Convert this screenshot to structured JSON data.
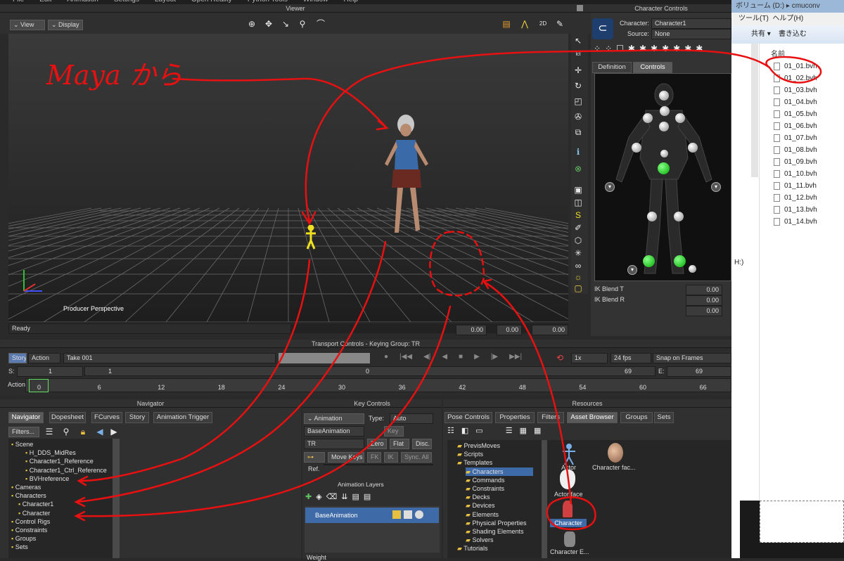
{
  "menubar": {
    "items": [
      "File",
      "Edit",
      "Animation",
      "Settings",
      "Layout",
      "Open Reality",
      "Python Tools",
      "Window",
      "Help"
    ]
  },
  "viewer": {
    "title": "Viewer",
    "view_btn": "View",
    "display_btn": "Display",
    "camera_label": "Producer Perspective",
    "status": "Ready",
    "coords": [
      "0.00",
      "0.00",
      "0.00"
    ],
    "handwriting": "Maya から"
  },
  "character_controls": {
    "title": "Character Controls",
    "character_label": "Character:",
    "character_value": "Character1",
    "source_label": "Source:",
    "source_value": "None",
    "tabs": [
      "Definition",
      "Controls"
    ],
    "active_tab": "Controls",
    "ik_rows": [
      {
        "label": "IK Blend T",
        "value": "0.00"
      },
      {
        "label": "IK Blend R",
        "value": "0.00"
      },
      {
        "label": "",
        "value": "0.00"
      }
    ]
  },
  "explorer": {
    "title_partial": "ボリューム (D:)",
    "path_partial": "cmuconv",
    "menu": [
      "ツール(T)",
      "ヘルプ(H)"
    ],
    "toolbar": [
      "共有 ▾",
      "書き込む"
    ],
    "column_header": "名前",
    "side_text": "H:)",
    "files": [
      "01_01.bvh",
      "01_02.bvh",
      "01_03.bvh",
      "01_04.bvh",
      "01_05.bvh",
      "01_06.bvh",
      "01_07.bvh",
      "01_08.bvh",
      "01_09.bvh",
      "01_10.bvh",
      "01_11.bvh",
      "01_12.bvh",
      "01_13.bvh",
      "01_14.bvh"
    ]
  },
  "transport": {
    "title": "Transport Controls  -  Keying Group: TR",
    "story": "Story",
    "action": "Action",
    "take": "Take 001",
    "speed": "1x",
    "fps": "24 fps",
    "snap": "Snap on Frames",
    "start_label": "S:",
    "start_value": "1",
    "current_value": "1",
    "center_value": "0",
    "end_frame": "69",
    "end_label": "E:",
    "end_value": "69",
    "action_label": "Action",
    "ticks": [
      "0",
      "6",
      "12",
      "18",
      "24",
      "30",
      "36",
      "42",
      "48",
      "54",
      "60",
      "66"
    ]
  },
  "navigator": {
    "title": "Navigator",
    "tabs": [
      "Navigator",
      "Dopesheet",
      "FCurves",
      "Story",
      "Animation Trigger"
    ],
    "filters": "Filters...",
    "tree": [
      {
        "label": "Scene",
        "indent": 0
      },
      {
        "label": "H_DDS_MidRes",
        "indent": 2
      },
      {
        "label": "Character1_Reference",
        "indent": 2
      },
      {
        "label": "Character1_Ctrl_Reference",
        "indent": 2
      },
      {
        "label": "BVHreference",
        "indent": 2
      },
      {
        "label": "Cameras",
        "indent": 0
      },
      {
        "label": "Characters",
        "indent": 0
      },
      {
        "label": "Character1",
        "indent": 1
      },
      {
        "label": "Character",
        "indent": 1
      },
      {
        "label": "Control Rigs",
        "indent": 0
      },
      {
        "label": "Constraints",
        "indent": 0
      },
      {
        "label": "Groups",
        "indent": 0
      },
      {
        "label": "Sets",
        "indent": 0
      }
    ]
  },
  "key_controls": {
    "title": "Key Controls",
    "animation_btn": "Animation",
    "type_label": "Type:",
    "type_value": "Auto",
    "layer_value": "BaseAnimation",
    "key_btn": "Key",
    "tr_value": "TR",
    "zero": "Zero",
    "flat": "Flat",
    "disc": "Disc.",
    "move_keys": "Move Keys",
    "fk": "FK",
    "ik": "IK",
    "sync_all": "Sync. All",
    "ref_label": "Ref.",
    "layers_title": "Animation Layers",
    "layer_item": "BaseAnimation",
    "weight": "Weight"
  },
  "resources": {
    "title": "Resources",
    "tabs": [
      "Pose Controls",
      "Properties",
      "Filters",
      "Asset Browser",
      "Groups",
      "Sets"
    ],
    "active_tab": "Asset Browser",
    "tree": [
      "PrevisMoves",
      "Scripts",
      "Templates",
      "Characters",
      "Commands",
      "Constraints",
      "Decks",
      "Devices",
      "Elements",
      "Physical Properties",
      "Shading Elements",
      "Solvers",
      "Tutorials"
    ],
    "assets": [
      "Actor",
      "Character fac...",
      "Actor face",
      "Character",
      "Character E..."
    ]
  }
}
